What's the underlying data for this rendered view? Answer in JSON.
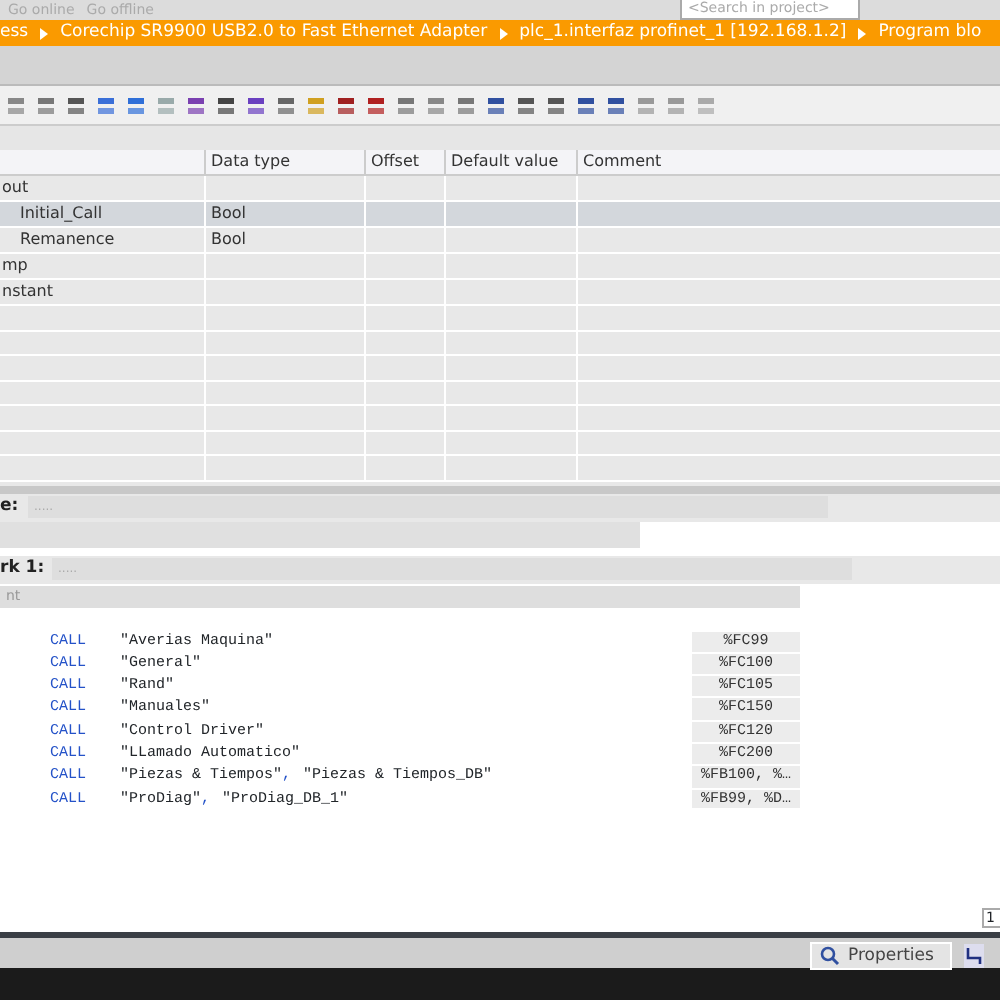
{
  "top_toolbar": {
    "buttons": [
      "Go online",
      "Go offline"
    ],
    "search": {
      "placeholder": "<Search in project>"
    }
  },
  "breadcrumb": [
    "ess",
    "Corechip SR9900 USB2.0 to Fast Ethernet Adapter",
    "plc_1.interfaz profinet_1 [192.168.1.2]",
    "Program blo"
  ],
  "interface_table": {
    "columns": [
      "",
      "Data type",
      "Offset",
      "Default value",
      "Comment"
    ],
    "rows": [
      {
        "name": "out",
        "data_type": "",
        "indent": false,
        "selected": false
      },
      {
        "name": "Initial_Call",
        "data_type": "Bool",
        "indent": true,
        "selected": true
      },
      {
        "name": "Remanence",
        "data_type": "Bool",
        "indent": true,
        "selected": false
      },
      {
        "name": "mp",
        "data_type": "",
        "indent": false,
        "selected": false
      },
      {
        "name": "nstant",
        "data_type": "",
        "indent": false,
        "selected": false
      }
    ]
  },
  "block_title": {
    "label": "e:",
    "value": "....."
  },
  "network": {
    "label": "rk 1:",
    "title": ".....",
    "comment_placeholder": "nt",
    "lines": [
      {
        "keyword": "CALL",
        "parts": [
          "\"Averias Maquina\""
        ],
        "address": "%FC99"
      },
      {
        "keyword": "CALL",
        "parts": [
          "\"General\""
        ],
        "address": "%FC100"
      },
      {
        "keyword": "CALL",
        "parts": [
          "\"Rand\""
        ],
        "address": "%FC105"
      },
      {
        "keyword": "CALL",
        "parts": [
          "\"Manuales\""
        ],
        "address": "%FC150"
      },
      {
        "keyword": "CALL",
        "parts": [
          "\"Control Driver\""
        ],
        "address": "%FC120"
      },
      {
        "keyword": "CALL",
        "parts": [
          "\"LLamado Automatico\""
        ],
        "address": "%FC200"
      },
      {
        "keyword": "CALL",
        "parts": [
          "\"Piezas & Tiempos\"",
          ",",
          "\"Piezas & Tiempos_DB\""
        ],
        "address": "%FB100, %…"
      },
      {
        "keyword": "CALL",
        "parts": [
          "\"ProDiag\"",
          ",",
          "\"ProDiag_DB_1\""
        ],
        "address": "%FB99, %D…"
      }
    ]
  },
  "zoom_field": {
    "value": "1"
  },
  "bottom_tabs": [
    "Properties"
  ]
}
